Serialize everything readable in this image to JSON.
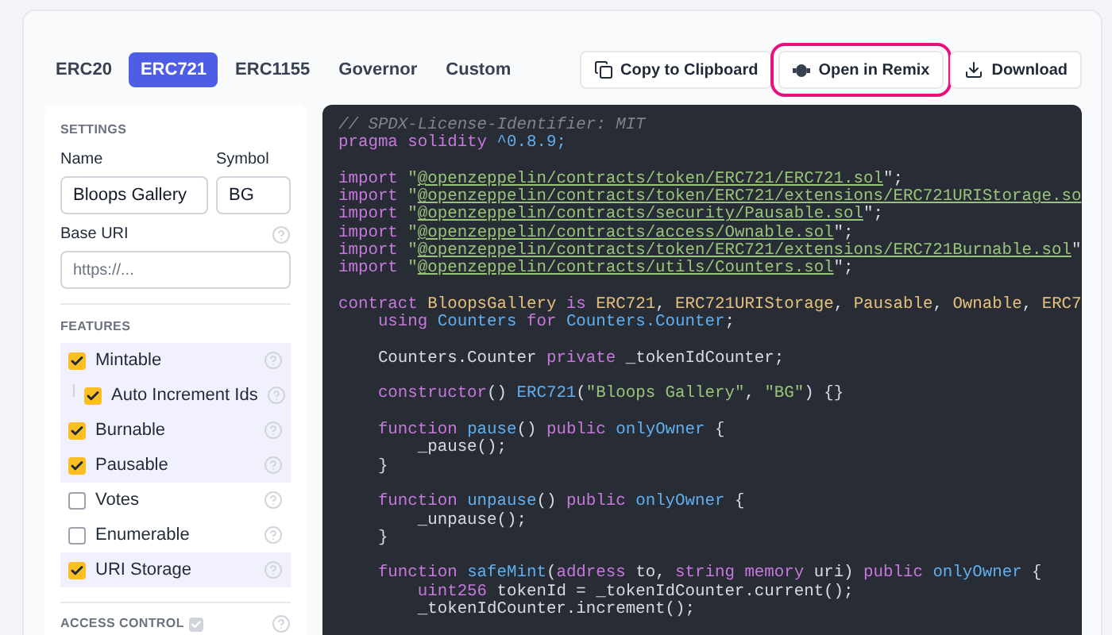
{
  "tabs": [
    {
      "label": "ERC20",
      "selected": false
    },
    {
      "label": "ERC721",
      "selected": true
    },
    {
      "label": "ERC1155",
      "selected": false
    },
    {
      "label": "Governor",
      "selected": false
    },
    {
      "label": "Custom",
      "selected": false
    }
  ],
  "actions": [
    {
      "label": "Copy to Clipboard",
      "kind": "copy",
      "highlighted": false
    },
    {
      "label": "Open in Remix",
      "kind": "remix",
      "highlighted": true
    },
    {
      "label": "Download",
      "kind": "download",
      "highlighted": false
    }
  ],
  "settings": {
    "heading": "SETTINGS",
    "name_label": "Name",
    "name_value": "Bloops Gallery",
    "symbol_label": "Symbol",
    "symbol_value": "BG",
    "base_uri_label": "Base URI",
    "base_uri_placeholder": "https://..."
  },
  "features": {
    "heading": "FEATURES",
    "items": [
      {
        "label": "Mintable",
        "checked": true,
        "children": [
          {
            "label": "Auto Increment Ids",
            "checked": true
          }
        ]
      },
      {
        "label": "Burnable",
        "checked": true
      },
      {
        "label": "Pausable",
        "checked": true
      },
      {
        "label": "Votes",
        "checked": false
      },
      {
        "label": "Enumerable",
        "checked": false
      },
      {
        "label": "URI Storage",
        "checked": true
      }
    ]
  },
  "access_control": {
    "heading": "ACCESS CONTROL",
    "checked": true
  },
  "code": [
    {
      "kind": "code",
      "segments": [
        {
          "text": "// SPDX-License-Identifier: MIT",
          "kind": "comment"
        }
      ]
    },
    {
      "kind": "code",
      "segments": [
        {
          "text": "pragma solidity ",
          "kind": "keyword"
        },
        {
          "text": "^0.8.9;",
          "kind": "number"
        }
      ]
    },
    {
      "kind": "blank"
    },
    {
      "kind": "code",
      "segments": [
        {
          "text": "import ",
          "kind": "keyword"
        },
        {
          "text": "\"",
          "kind": "string"
        },
        {
          "text": "@openzeppelin/contracts/token/ERC721/ERC721.sol",
          "kind": "path"
        },
        {
          "text": "\";",
          "kind": "plain"
        }
      ]
    },
    {
      "kind": "code",
      "segments": [
        {
          "text": "import ",
          "kind": "keyword"
        },
        {
          "text": "\"",
          "kind": "string"
        },
        {
          "text": "@openzeppelin/contracts/token/ERC721/extensions/ERC721URIStorage.so",
          "kind": "path"
        }
      ]
    },
    {
      "kind": "code",
      "segments": [
        {
          "text": "import ",
          "kind": "keyword"
        },
        {
          "text": "\"",
          "kind": "string"
        },
        {
          "text": "@openzeppelin/contracts/security/Pausable.sol",
          "kind": "path"
        },
        {
          "text": "\";",
          "kind": "plain"
        }
      ]
    },
    {
      "kind": "code",
      "segments": [
        {
          "text": "import ",
          "kind": "keyword"
        },
        {
          "text": "\"",
          "kind": "string"
        },
        {
          "text": "@openzeppelin/contracts/access/Ownable.sol",
          "kind": "path"
        },
        {
          "text": "\";",
          "kind": "plain"
        }
      ]
    },
    {
      "kind": "code",
      "segments": [
        {
          "text": "import ",
          "kind": "keyword"
        },
        {
          "text": "\"",
          "kind": "string"
        },
        {
          "text": "@openzeppelin/contracts/token/ERC721/extensions/ERC721Burnable.sol",
          "kind": "path"
        },
        {
          "text": "\"",
          "kind": "plain"
        }
      ]
    },
    {
      "kind": "code",
      "segments": [
        {
          "text": "import ",
          "kind": "keyword"
        },
        {
          "text": "\"",
          "kind": "string"
        },
        {
          "text": "@openzeppelin/contracts/utils/Counters.sol",
          "kind": "path"
        },
        {
          "text": "\";",
          "kind": "plain"
        }
      ]
    },
    {
      "kind": "blank"
    },
    {
      "kind": "code",
      "segments": [
        {
          "text": "contract ",
          "kind": "keyword"
        },
        {
          "text": "BloopsGallery ",
          "kind": "type"
        },
        {
          "text": "is ",
          "kind": "keyword"
        },
        {
          "text": "ERC721",
          "kind": "type"
        },
        {
          "text": ", ",
          "kind": "plain"
        },
        {
          "text": "ERC721URIStorage",
          "kind": "type"
        },
        {
          "text": ", ",
          "kind": "plain"
        },
        {
          "text": "Pausable",
          "kind": "type"
        },
        {
          "text": ", ",
          "kind": "plain"
        },
        {
          "text": "Ownable",
          "kind": "type"
        },
        {
          "text": ", ",
          "kind": "plain"
        },
        {
          "text": "ERC7",
          "kind": "type"
        }
      ]
    },
    {
      "kind": "code",
      "segments": [
        {
          "text": "    using ",
          "kind": "keyword"
        },
        {
          "text": "Counters ",
          "kind": "func"
        },
        {
          "text": "for ",
          "kind": "keyword"
        },
        {
          "text": "Counters.Counter",
          "kind": "func"
        },
        {
          "text": ";",
          "kind": "plain"
        }
      ]
    },
    {
      "kind": "blank"
    },
    {
      "kind": "code",
      "segments": [
        {
          "text": "    Counters.Counter ",
          "kind": "plain"
        },
        {
          "text": "private ",
          "kind": "keyword"
        },
        {
          "text": "_tokenIdCounter;",
          "kind": "plain"
        }
      ]
    },
    {
      "kind": "blank"
    },
    {
      "kind": "code",
      "segments": [
        {
          "text": "    constructor",
          "kind": "keyword"
        },
        {
          "text": "() ",
          "kind": "plain"
        },
        {
          "text": "ERC721",
          "kind": "func"
        },
        {
          "text": "(",
          "kind": "plain"
        },
        {
          "text": "\"Bloops Gallery\"",
          "kind": "string"
        },
        {
          "text": ", ",
          "kind": "plain"
        },
        {
          "text": "\"BG\"",
          "kind": "string"
        },
        {
          "text": ") {}",
          "kind": "plain"
        }
      ]
    },
    {
      "kind": "blank"
    },
    {
      "kind": "code",
      "segments": [
        {
          "text": "    function ",
          "kind": "keyword"
        },
        {
          "text": "pause",
          "kind": "func"
        },
        {
          "text": "() ",
          "kind": "plain"
        },
        {
          "text": "public ",
          "kind": "keyword"
        },
        {
          "text": "onlyOwner ",
          "kind": "func"
        },
        {
          "text": "{",
          "kind": "plain"
        }
      ]
    },
    {
      "kind": "code",
      "segments": [
        {
          "text": "        _pause();",
          "kind": "plain"
        }
      ]
    },
    {
      "kind": "code",
      "segments": [
        {
          "text": "    }",
          "kind": "plain"
        }
      ]
    },
    {
      "kind": "blank"
    },
    {
      "kind": "code",
      "segments": [
        {
          "text": "    function ",
          "kind": "keyword"
        },
        {
          "text": "unpause",
          "kind": "func"
        },
        {
          "text": "() ",
          "kind": "plain"
        },
        {
          "text": "public ",
          "kind": "keyword"
        },
        {
          "text": "onlyOwner ",
          "kind": "func"
        },
        {
          "text": "{",
          "kind": "plain"
        }
      ]
    },
    {
      "kind": "code",
      "segments": [
        {
          "text": "        _unpause();",
          "kind": "plain"
        }
      ]
    },
    {
      "kind": "code",
      "segments": [
        {
          "text": "    }",
          "kind": "plain"
        }
      ]
    },
    {
      "kind": "blank"
    },
    {
      "kind": "code",
      "segments": [
        {
          "text": "    function ",
          "kind": "keyword"
        },
        {
          "text": "safeMint",
          "kind": "func"
        },
        {
          "text": "(",
          "kind": "plain"
        },
        {
          "text": "address ",
          "kind": "keyword"
        },
        {
          "text": "to, ",
          "kind": "plain"
        },
        {
          "text": "string memory ",
          "kind": "keyword"
        },
        {
          "text": "uri) ",
          "kind": "plain"
        },
        {
          "text": "public ",
          "kind": "keyword"
        },
        {
          "text": "onlyOwner ",
          "kind": "func"
        },
        {
          "text": "{",
          "kind": "plain"
        }
      ]
    },
    {
      "kind": "code",
      "segments": [
        {
          "text": "        uint256 ",
          "kind": "keyword"
        },
        {
          "text": "tokenId = _tokenIdCounter.current();",
          "kind": "plain"
        }
      ]
    },
    {
      "kind": "code",
      "segments": [
        {
          "text": "        _tokenIdCounter.increment();",
          "kind": "plain"
        }
      ]
    }
  ]
}
